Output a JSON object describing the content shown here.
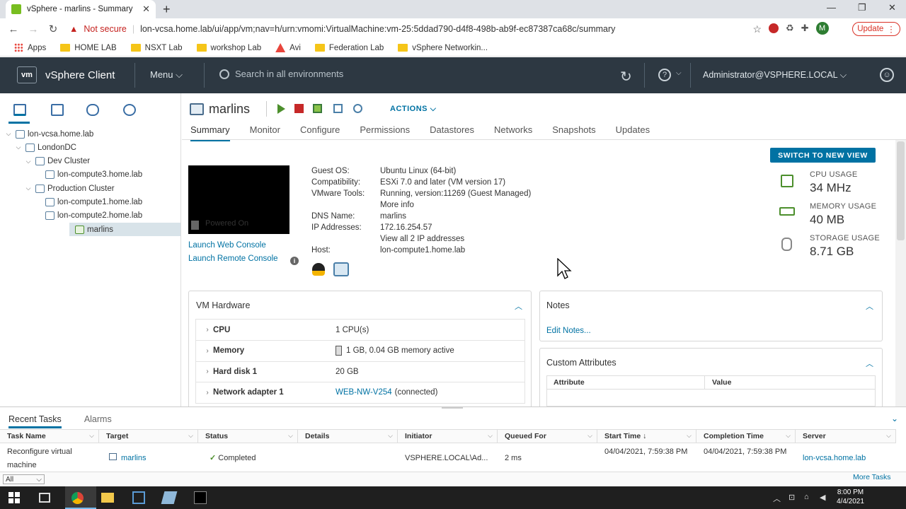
{
  "browser": {
    "tab_title": "vSphere - marlins - Summary",
    "new_tab": "+",
    "not_secure": "Not secure",
    "url": "lon-vcsa.home.lab/ui/app/vm;nav=h/urn:vmomi:VirtualMachine:vm-25:5ddad790-d4f8-498b-ab9f-ec87387ca68c/summary",
    "profile_initial": "M",
    "update_label": "Update",
    "bookmarks": [
      "Apps",
      "HOME LAB",
      "NSXT Lab",
      "workshop Lab",
      "Avi",
      "Federation Lab",
      "vSphere Networkin..."
    ]
  },
  "header": {
    "logo": "vm",
    "app_title": "vSphere Client",
    "menu_label": "Menu",
    "search_placeholder": "Search in all environments",
    "user": "Administrator@VSPHERE.LOCAL"
  },
  "tree": [
    {
      "label": "lon-vcsa.home.lab",
      "depth": 0,
      "caret": "⌵",
      "icon": "vcenter-icon"
    },
    {
      "label": "LondonDC",
      "depth": 1,
      "caret": "⌵",
      "icon": "datacenter-icon"
    },
    {
      "label": "Dev Cluster",
      "depth": 2,
      "caret": "⌵",
      "icon": "cluster-icon"
    },
    {
      "label": "lon-compute3.home.lab",
      "depth": 3,
      "caret": "",
      "icon": "host-icon"
    },
    {
      "label": "Production Cluster",
      "depth": 2,
      "caret": "⌵",
      "icon": "cluster-icon"
    },
    {
      "label": "lon-compute1.home.lab",
      "depth": 3,
      "caret": "",
      "icon": "host-icon"
    },
    {
      "label": "lon-compute2.home.lab",
      "depth": 3,
      "caret": "",
      "icon": "host-icon"
    },
    {
      "label": "marlins",
      "depth": 3,
      "caret": "",
      "icon": "vm-icon",
      "selected": true
    }
  ],
  "vm": {
    "name": "marlins",
    "actions_label": "ACTIONS",
    "tabs": [
      "Summary",
      "Monitor",
      "Configure",
      "Permissions",
      "Datastores",
      "Networks",
      "Snapshots",
      "Updates"
    ],
    "active_tab": "Summary",
    "switch_view": "SWITCH TO NEW VIEW",
    "powered_on": "Powered On",
    "launch_web_console": "Launch Web Console",
    "launch_remote_console": "Launch Remote Console",
    "info_icon_glyph": "i",
    "details": {
      "guest_os_label": "Guest OS:",
      "guest_os": "Ubuntu Linux (64-bit)",
      "compat_label": "Compatibility:",
      "compat": "ESXi 7.0 and later (VM version 17)",
      "tools_label": "VMware Tools:",
      "tools": "Running, version:11269 (Guest Managed)",
      "more_info": "More info",
      "dns_label": "DNS Name:",
      "dns": "marlins",
      "ip_label": "IP Addresses:",
      "ip": "172.16.254.57",
      "view_ips": "View all 2 IP addresses",
      "host_label": "Host:",
      "host": "lon-compute1.home.lab"
    },
    "usage": {
      "cpu_label": "CPU USAGE",
      "cpu": "34 MHz",
      "mem_label": "MEMORY USAGE",
      "mem": "40 MB",
      "storage_label": "STORAGE USAGE",
      "storage": "8.71 GB"
    },
    "hardware": {
      "title": "VM Hardware",
      "rows": [
        {
          "k": "CPU",
          "v": "1 CPU(s)"
        },
        {
          "k": "Memory",
          "v": "1 GB, 0.04 GB memory active"
        },
        {
          "k": "Hard disk 1",
          "v": "20 GB"
        },
        {
          "k": "Network adapter 1",
          "v": "WEB-NW-V254",
          "v2": "(connected)"
        }
      ]
    },
    "notes": {
      "title": "Notes",
      "edit": "Edit Notes..."
    },
    "custom_attributes": {
      "title": "Custom Attributes",
      "col1": "Attribute",
      "col2": "Value"
    }
  },
  "tasks": {
    "tab1": "Recent Tasks",
    "tab2": "Alarms",
    "columns": [
      "Task Name",
      "Target",
      "Status",
      "Details",
      "Initiator",
      "Queued For",
      "Start Time ↓",
      "Completion Time",
      "Server"
    ],
    "row": {
      "task_name": "Reconfigure virtual machine",
      "target": "marlins",
      "status": "Completed",
      "details": "",
      "initiator": "VSPHERE.LOCAL\\Ad...",
      "queued": "2 ms",
      "start": "04/04/2021, 7:59:38 PM",
      "completion": "04/04/2021, 7:59:38 PM",
      "server": "lon-vcsa.home.lab"
    },
    "filter": "All",
    "more": "More Tasks"
  },
  "taskbar": {
    "time": "8:00 PM",
    "date": "4/4/2021"
  }
}
